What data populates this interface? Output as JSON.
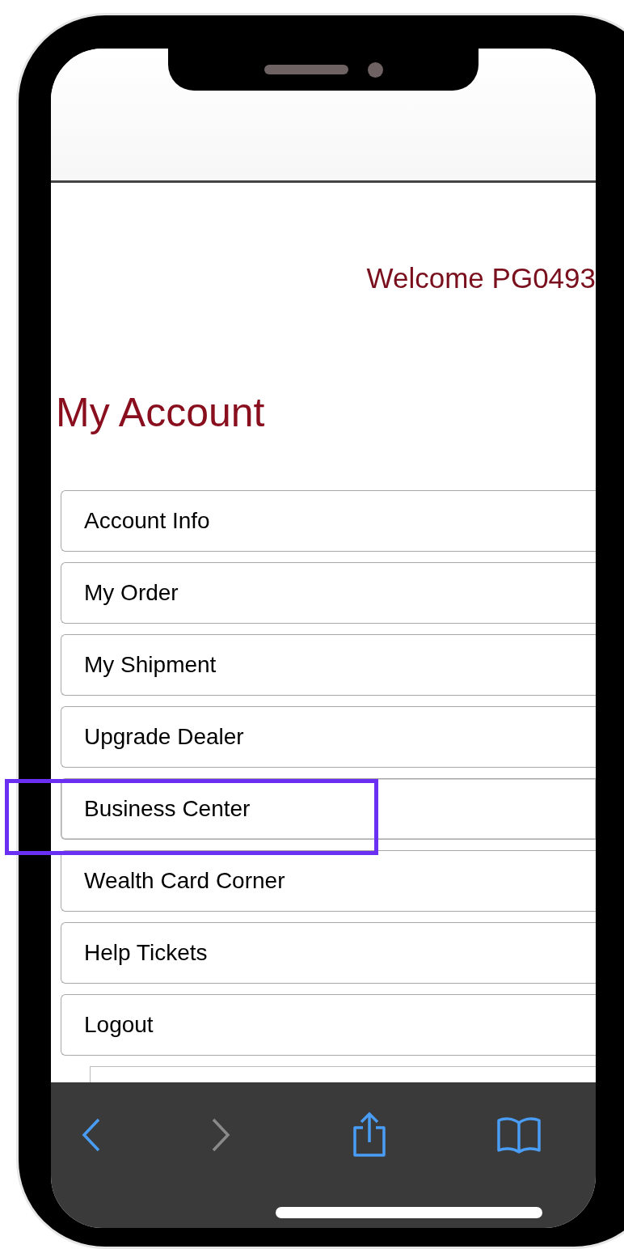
{
  "header": {
    "welcome": "Welcome PG0493"
  },
  "page_title": "My Account",
  "menu_items": [
    {
      "label": "Account Info",
      "highlighted": false
    },
    {
      "label": "My Order",
      "highlighted": false
    },
    {
      "label": "My Shipment",
      "highlighted": false
    },
    {
      "label": "Upgrade Dealer",
      "highlighted": false
    },
    {
      "label": "Business Center",
      "highlighted": true
    },
    {
      "label": "Wealth Card Corner",
      "highlighted": false
    },
    {
      "label": "Help Tickets",
      "highlighted": false
    },
    {
      "label": "Logout",
      "highlighted": false
    }
  ],
  "toolbar": [
    {
      "kind": "back",
      "disabled": false
    },
    {
      "kind": "forward",
      "disabled": true
    },
    {
      "kind": "share",
      "disabled": false
    },
    {
      "kind": "bookmarks",
      "disabled": false
    }
  ]
}
